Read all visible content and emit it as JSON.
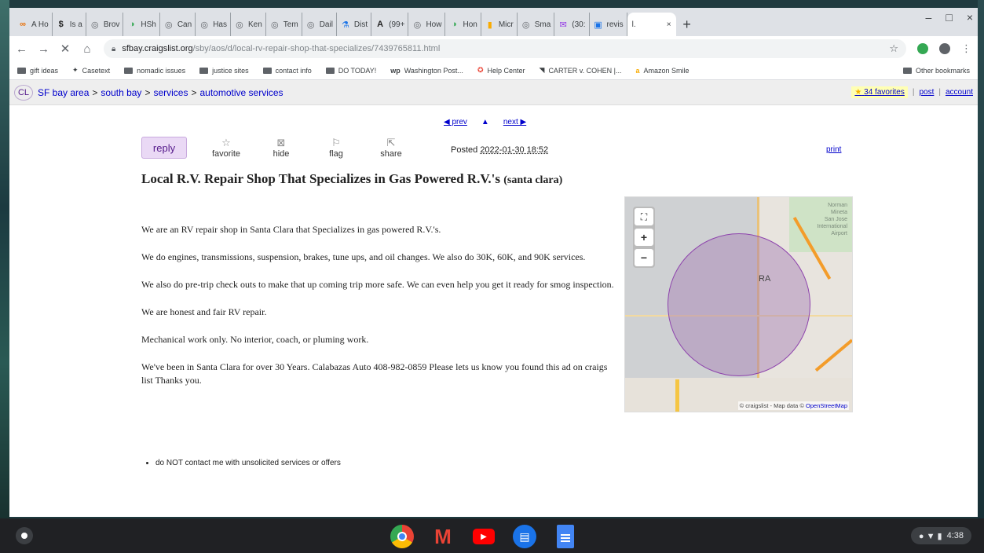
{
  "browser": {
    "tabs": [
      {
        "icon": "∞",
        "label": "A Ho",
        "color": "#e8710a"
      },
      {
        "icon": "$",
        "label": "Is a",
        "color": "#222222"
      },
      {
        "icon": "◎",
        "label": "Brov",
        "color": "#5f6368"
      },
      {
        "icon": "◑",
        "label": "HSh",
        "color": "#34a853"
      },
      {
        "icon": "◎",
        "label": "Can",
        "color": "#5f6368"
      },
      {
        "icon": "◎",
        "label": "Has",
        "color": "#5f6368"
      },
      {
        "icon": "◎",
        "label": "Ken",
        "color": "#5f6368"
      },
      {
        "icon": "◎",
        "label": "Tem",
        "color": "#5f6368"
      },
      {
        "icon": "◎",
        "label": "Dail",
        "color": "#5f6368"
      },
      {
        "icon": "⚗",
        "label": "Dist",
        "color": "#1a73e8"
      },
      {
        "icon": "A",
        "label": "(99+",
        "color": "#222222"
      },
      {
        "icon": "◎",
        "label": "How",
        "color": "#5f6368"
      },
      {
        "icon": "◑",
        "label": "Hon",
        "color": "#34a853"
      },
      {
        "icon": "▮",
        "label": "Micr",
        "color": "#f9ab00"
      },
      {
        "icon": "◎",
        "label": "Sma",
        "color": "#5f6368"
      },
      {
        "icon": "✉",
        "label": "(30:",
        "color": "#9334e6"
      },
      {
        "icon": "▣",
        "label": "revis",
        "color": "#1a73e8"
      }
    ],
    "active_tab": {
      "label": "l.",
      "close": "×"
    },
    "new_tab": "+",
    "window_controls": {
      "minimize": "–",
      "maximize": "□",
      "close": "×"
    },
    "url_host": "sfbay.craigslist.org",
    "url_path": "/sby/aos/d/local-rv-repair-shop-that-specializes/7439765811.html",
    "bookmarks": [
      {
        "label": "gift ideas",
        "type": "folder"
      },
      {
        "label": "Casetext",
        "type": "link",
        "icon": "✦"
      },
      {
        "label": "nomadic issues",
        "type": "folder"
      },
      {
        "label": "justice sites",
        "type": "folder"
      },
      {
        "label": "contact info",
        "type": "folder"
      },
      {
        "label": "DO TODAY!",
        "type": "folder"
      },
      {
        "label": "Washington Post...",
        "type": "link",
        "icon": "wp"
      },
      {
        "label": "Help Center",
        "type": "link",
        "icon": "✪"
      },
      {
        "label": "CARTER v. COHEN |...",
        "type": "link",
        "icon": "◥"
      },
      {
        "label": "Amazon Smile",
        "type": "link",
        "icon": "a"
      }
    ],
    "other_bookmarks": "Other bookmarks"
  },
  "craigslist": {
    "logo": "CL",
    "breadcrumbs": [
      "SF bay area",
      "south bay",
      "services",
      "automotive services"
    ],
    "crumb_sep": ">",
    "favorites": "34 favorites",
    "post": "post",
    "account": "account",
    "pager": {
      "prev": "◀ prev",
      "up": "▲",
      "next": "next ▶"
    },
    "reply": "reply",
    "actions": [
      {
        "icon": "☆",
        "label": "favorite",
        "name": "favorite"
      },
      {
        "icon": "⊠",
        "label": "hide",
        "name": "hide"
      },
      {
        "icon": "⚐",
        "label": "flag",
        "name": "flag"
      },
      {
        "icon": "⇱",
        "label": "share",
        "name": "share"
      }
    ],
    "posted_label": "Posted",
    "posted_date": "2022-01-30 18:52",
    "print": "print",
    "title": "Local R.V. Repair Shop That Specializes in Gas Powered R.V.'s",
    "location": "(santa clara)",
    "body": [
      "We are an RV repair shop in Santa Clara that Specializes in gas powered R.V.'s.",
      "We do engines, transmissions, suspension, brakes, tune ups, and oil changes. We also do 30K, 60K, and 90K services.",
      "We also do pre-trip check outs to make that up coming trip more safe. We can even help you get it ready for smog inspection.",
      "We are honest and fair RV repair.",
      "Mechanical work only. No interior, coach, or pluming work.",
      "We've been in Santa Clara for over 30 Years. Calabazas Auto 408-982-0859 Please lets us know you found this ad on craigs list Thanks you."
    ],
    "notices": [
      "do NOT contact me with unsolicited services or offers"
    ],
    "map": {
      "label": "RA",
      "airport_lines": [
        "Norman",
        "Mineta",
        "San Jose",
        "International",
        "Airport"
      ],
      "attribution": "© craigslist - Map data ©",
      "osm": "OpenStreetMap",
      "ctrl_fullscreen": "⛶",
      "ctrl_zoom_in": "+",
      "ctrl_zoom_out": "−"
    }
  },
  "shelf": {
    "apps": [
      "chrome",
      "gmail",
      "youtube",
      "messages",
      "docs"
    ],
    "gmail_glyph": "M",
    "youtube_glyph": "▶",
    "messages_glyph": "▤",
    "tray_icons": "● ▼ ▮",
    "time": "4:38"
  },
  "colors": {
    "link": "#0000cc",
    "reply_bg": "#ead9f5",
    "circle": "#8e44ad"
  }
}
